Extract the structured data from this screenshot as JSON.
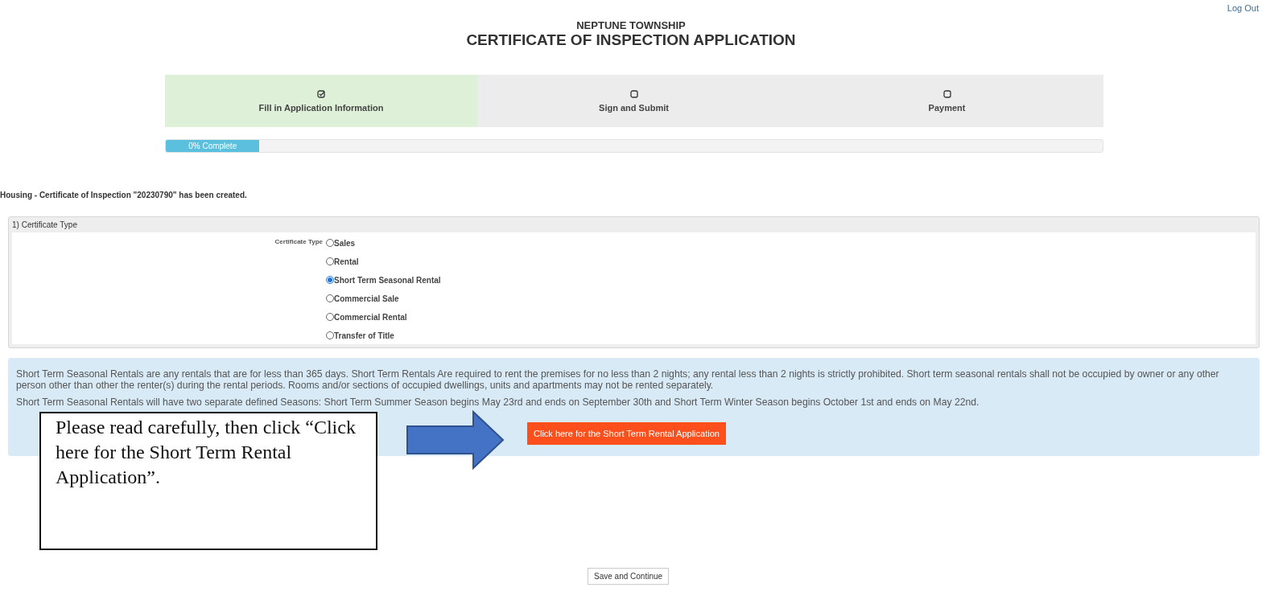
{
  "header": {
    "logout": "Log Out",
    "subtitle": "NEPTUNE TOWNSHIP",
    "title": "CERTIFICATE OF INSPECTION APPLICATION"
  },
  "steps": [
    {
      "label": "Fill in Application Information",
      "completed": true
    },
    {
      "label": "Sign and Submit",
      "completed": false
    },
    {
      "label": "Payment",
      "completed": false
    }
  ],
  "progress": {
    "level": 0.1,
    "label": "0% Complete"
  },
  "message": "Housing - Certificate of Inspection \"20230790\" has been created.",
  "section": {
    "title": "1) Certificate Type",
    "field_label": "Certificate Type",
    "options": [
      {
        "label": "Sales",
        "selected": false
      },
      {
        "label": "Rental",
        "selected": false
      },
      {
        "label": "Short Term Seasonal Rental",
        "selected": true
      },
      {
        "label": "Commercial Sale",
        "selected": false
      },
      {
        "label": "Commercial Rental",
        "selected": false
      },
      {
        "label": "Transfer of Title",
        "selected": false
      }
    ]
  },
  "info": {
    "paragraphs": [
      "Short Term Seasonal Rentals are any rentals that are for less than 365 days. Short Term Rentals Are required to rent the premises for no less than 2 nights; any rental less than 2 nights is strictly prohibited. Short term seasonal rentals shall not be occupied by owner or any other person other than other the renter(s) during the rental periods. Rooms and/or sections of occupied dwellings, units and apartments may not be rented separately.",
      "Short Term Seasonal Rentals will have two separate defined Seasons: Short Term Summer Season begins May 23rd and ends on September 30th and Short Term Winter Season begins October 1st and ends on May 22nd."
    ],
    "button": "Click here for the Short Term Rental Application"
  },
  "callout": "Please read carefully, then click “Click here for the Short Term Rental Application”.",
  "save_button": "Save and Continue"
}
